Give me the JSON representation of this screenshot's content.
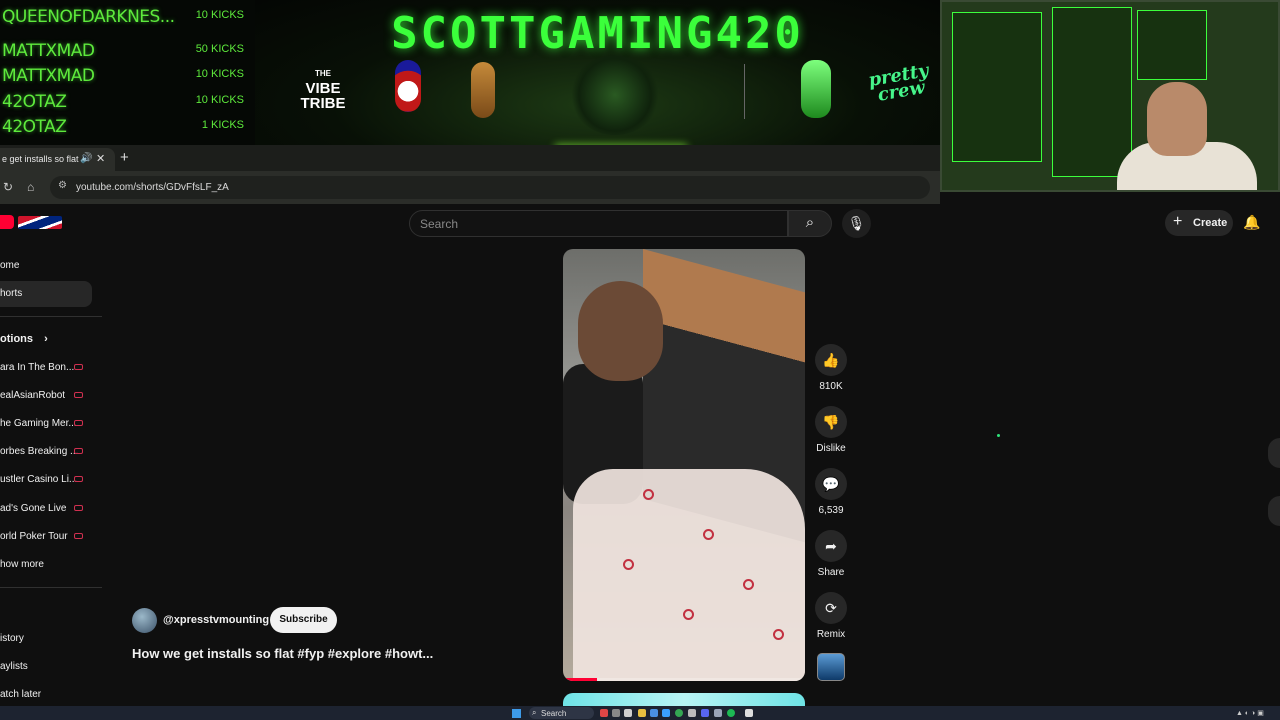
{
  "stream_overlay": {
    "recent_kicks": [
      {
        "name": "QUEENOFDARKNES...",
        "amount": "10 KICKS"
      },
      {
        "name": "MATTXMAD",
        "amount": "50 KICKS"
      },
      {
        "name": "MATTXMAD",
        "amount": "10 KICKS"
      },
      {
        "name": "42OTAZ",
        "amount": "10 KICKS"
      },
      {
        "name": "42OTAZ",
        "amount": "1 KICKS"
      }
    ],
    "banner_title": "SCOTTGAMING420",
    "sponsors": {
      "vibe_tribe_small": "THE",
      "vibe_tribe": "VIBE TRIBE",
      "pretty_crew": "pretty crew"
    }
  },
  "browser": {
    "tab_title": "e get installs so flat",
    "tab_audio_icon": "speaker-icon",
    "tab_close": "✕",
    "new_tab": "+",
    "url": "youtube.com/shorts/GDvFfsLF_zA"
  },
  "youtube": {
    "search_placeholder": "Search",
    "create_label": "Create",
    "sidebar": {
      "nav": [
        {
          "label": "ome",
          "active": false
        },
        {
          "label": "horts",
          "active": true
        }
      ],
      "subscriptions_title": "otions",
      "subscriptions": [
        {
          "label": "ara In The Bon..."
        },
        {
          "label": "ealAsianRobot"
        },
        {
          "label": "he Gaming Mer..."
        },
        {
          "label": "orbes Breaking ..."
        },
        {
          "label": "ustler Casino Li..."
        },
        {
          "label": "ad's Gone Live"
        },
        {
          "label": "orld Poker Tour"
        }
      ],
      "show_more": "how more",
      "you": [
        {
          "label": "istory"
        },
        {
          "label": "aylists"
        },
        {
          "label": "atch later"
        }
      ]
    },
    "short": {
      "channel": "@xpresstvmounting",
      "subscribe_label": "Subscribe",
      "title": "How we get installs so flat #fyp #explore #howt...",
      "progress": 0.14,
      "actions": {
        "like_count": "810K",
        "dislike_label": "Dislike",
        "comment_count": "6,539",
        "share_label": "Share",
        "remix_label": "Remix"
      }
    }
  },
  "taskbar": {
    "search_label": "Search"
  },
  "colors": {
    "overlay_green": "#5eea3c",
    "youtube_red": "#ff0033",
    "page_bg": "#0f0f0f"
  }
}
